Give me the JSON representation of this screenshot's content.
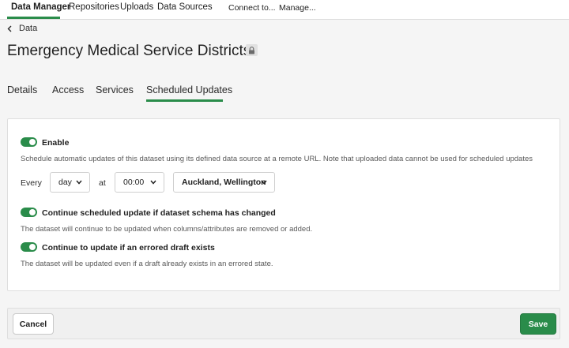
{
  "topnav": {
    "items": [
      "Data Manager",
      "Repositories",
      "Uploads",
      "Data Sources",
      "Connect to...",
      "Manage..."
    ]
  },
  "breadcrumb": {
    "back_label": "Data"
  },
  "page": {
    "title": "Emergency Medical Service Districts",
    "lock_icon": "lock-icon"
  },
  "tabs": [
    "Details",
    "Access",
    "Services",
    "Scheduled Updates"
  ],
  "active_tab": "Scheduled Updates",
  "schedule": {
    "enable_label": "Enable",
    "enabled": true,
    "description": "Schedule automatic updates of this dataset using its defined data source at a remote URL. Note that uploaded data cannot be used for scheduled updates",
    "every_label": "Every",
    "interval_value": "day",
    "at_label": "at",
    "time_value": "00:00",
    "timezone_value": "Auckland, Wellington",
    "schema_change_label": "Continue scheduled update if dataset schema has changed",
    "schema_change_enabled": true,
    "schema_change_desc": "The dataset will continue to be updated when columns/attributes are removed or added.",
    "errored_draft_label": "Continue to update if an errored draft exists",
    "errored_draft_enabled": true,
    "errored_draft_desc": "The dataset will be updated even if a draft already exists in an errored state."
  },
  "footer": {
    "cancel_label": "Cancel",
    "save_label": "Save"
  },
  "colors": {
    "accent": "#2a8c4a"
  }
}
